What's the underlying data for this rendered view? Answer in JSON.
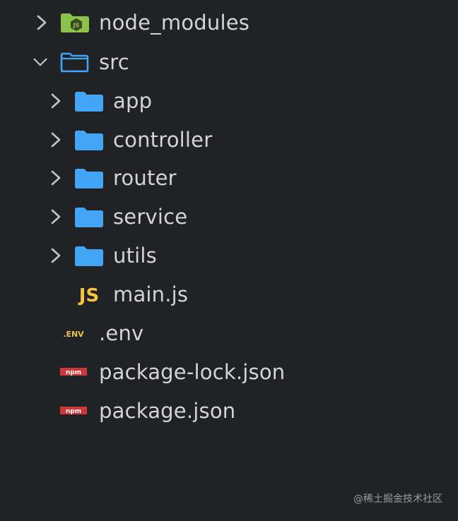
{
  "explorer": {
    "items": [
      {
        "label": "node_modules",
        "type": "folder",
        "state": "collapsed",
        "icon": "node-modules-folder-icon"
      },
      {
        "label": "src",
        "type": "folder",
        "state": "expanded",
        "icon": "folder-open-icon"
      },
      {
        "label": "app",
        "type": "folder",
        "state": "collapsed",
        "icon": "folder-icon"
      },
      {
        "label": "controller",
        "type": "folder",
        "state": "collapsed",
        "icon": "folder-icon"
      },
      {
        "label": "router",
        "type": "folder",
        "state": "collapsed",
        "icon": "folder-icon"
      },
      {
        "label": "service",
        "type": "folder",
        "state": "collapsed",
        "icon": "folder-icon"
      },
      {
        "label": "utils",
        "type": "folder",
        "state": "collapsed",
        "icon": "folder-icon"
      },
      {
        "label": "main.js",
        "type": "file",
        "icon": "javascript-file-icon",
        "icon_text": "JS"
      },
      {
        "label": ".env",
        "type": "file",
        "icon": "env-file-icon",
        "icon_text": ".ENV"
      },
      {
        "label": "package-lock.json",
        "type": "file",
        "icon": "npm-file-icon",
        "icon_text": "npm"
      },
      {
        "label": "package.json",
        "type": "file",
        "icon": "npm-file-icon",
        "icon_text": "npm"
      }
    ]
  },
  "watermark": "@稀土掘金技术社区",
  "colors": {
    "background": "#202226",
    "folder": "#42a5f5",
    "node_folder": "#8bc34a",
    "js": "#f5c242",
    "env": "#e8c547",
    "npm": "#cb3837",
    "chevron": "#c5c5c5",
    "text": "#d4d4d4"
  }
}
